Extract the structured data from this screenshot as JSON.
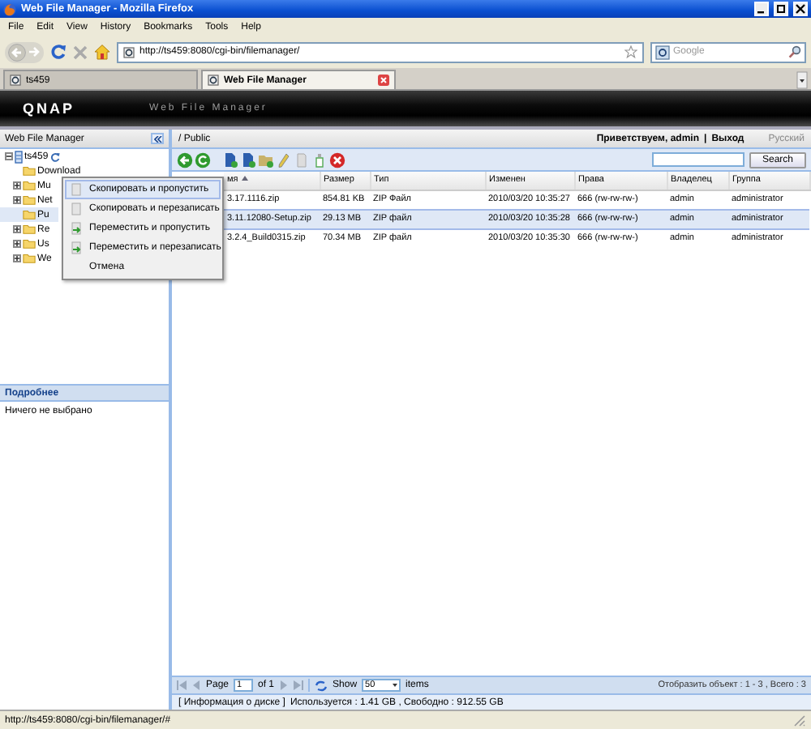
{
  "window": {
    "title": "Web File Manager - Mozilla Firefox"
  },
  "menu_bar": [
    "File",
    "Edit",
    "View",
    "History",
    "Bookmarks",
    "Tools",
    "Help"
  ],
  "address_bar": {
    "value": "http://ts459:8080/cgi-bin/filemanager/"
  },
  "search_bar": {
    "placeholder": "Google"
  },
  "tabs": [
    {
      "label": "ts459",
      "selected": false
    },
    {
      "label": "Web File Manager",
      "selected": true
    }
  ],
  "app_header": {
    "logo": "QNAP",
    "subtitle": "Web File Manager"
  },
  "sidebar": {
    "title": "Web File Manager",
    "tree": {
      "label": "ts459",
      "expanded": true,
      "children": [
        {
          "label": "Download",
          "expandable": false,
          "selected": false
        },
        {
          "label": "Mu",
          "expandable": true,
          "selected": false
        },
        {
          "label": "Net",
          "expandable": true,
          "selected": false
        },
        {
          "label": "Pu",
          "expandable": false,
          "selected": true
        },
        {
          "label": "Re",
          "expandable": true,
          "selected": false
        },
        {
          "label": "Us",
          "expandable": true,
          "selected": false
        },
        {
          "label": "We",
          "expandable": true,
          "selected": false
        }
      ]
    }
  },
  "details": {
    "title": "Подробнее",
    "text": "Ничего не выбрано"
  },
  "path": "/ Public",
  "user_bar": {
    "greeting": "Приветствуем, admin",
    "separator": "|",
    "logout": "Выход",
    "language": "Русский"
  },
  "toolbar": {
    "search_button": "Search"
  },
  "table": {
    "columns": [
      {
        "label": "мя",
        "sorted": true
      },
      {
        "label": "Размер",
        "sorted": false
      },
      {
        "label": "Тип",
        "sorted": false
      },
      {
        "label": "Изменен",
        "sorted": false
      },
      {
        "label": "Права",
        "sorted": false
      },
      {
        "label": "Владелец",
        "sorted": false
      },
      {
        "label": "Группа",
        "sorted": false
      }
    ],
    "rows": [
      {
        "cells": [
          "3.17.1116.zip",
          "854.81 KB",
          "ZIP Файл",
          "2010/03/20 10:35:27",
          "666 (rw-rw-rw-)",
          "admin",
          "administrator"
        ],
        "selected": false
      },
      {
        "cells": [
          "3.11.12080-Setup.zip",
          "29.13 MB",
          "ZIP файл",
          "2010/03/20 10:35:28",
          "666 (rw-rw-rw-)",
          "admin",
          "administrator"
        ],
        "selected": true
      },
      {
        "cells": [
          "3.2.4_Build0315.zip",
          "70.34 MB",
          "ZIP файл",
          "2010/03/20 10:35:30",
          "666 (rw-rw-rw-)",
          "admin",
          "administrator"
        ],
        "selected": false
      }
    ]
  },
  "context_menu": [
    {
      "label": "Скопировать и пропустить",
      "kind": "copy",
      "selected": true
    },
    {
      "label": "Скопировать и перезаписать",
      "kind": "copy",
      "selected": false
    },
    {
      "label": "Переместить и пропустить",
      "kind": "move",
      "selected": false
    },
    {
      "label": "Переместить и перезаписать",
      "kind": "move",
      "selected": false
    },
    {
      "label": "Отмена",
      "kind": "cancel",
      "selected": false
    }
  ],
  "pager": {
    "page_label": "Page",
    "page": "1",
    "of": "of 1",
    "show_label": "Show",
    "page_size": "50",
    "items_label": "items",
    "summary": "Отобразить объект : 1 - 3 , Всего : 3"
  },
  "disk_info": {
    "link": "[ Информация о диске ]",
    "text": "Используется : 1.41 GB , Свободно : 912.55 GB"
  },
  "status_bar": "http://ts459:8080/cgi-bin/filemanager/#"
}
